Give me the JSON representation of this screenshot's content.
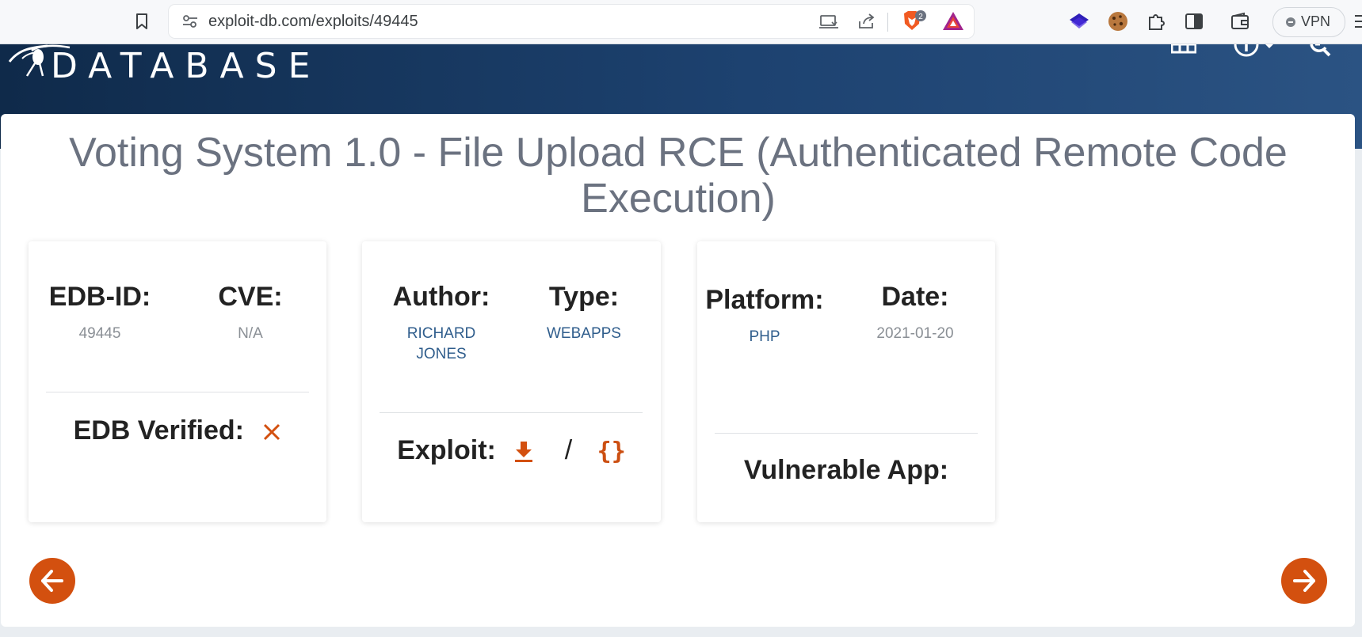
{
  "browser": {
    "url": "exploit-db.com/exploits/49445",
    "brave_shield_count": "2",
    "vpn_label": "VPN",
    "icons": [
      "bookmark-icon",
      "site-info-icon",
      "cast-icon",
      "share-icon",
      "brave-shield-icon",
      "brave-rewards-icon",
      "layers-extension-icon",
      "cookie-extension-icon",
      "puzzle-extension-icon",
      "sidebar-icon",
      "wallet-icon",
      "vpn-status-icon",
      "menu-icon"
    ]
  },
  "header": {
    "logo_text": "DATABASE",
    "icons": [
      "spider-logo-icon",
      "grid-icon",
      "info-icon",
      "chevron-down-icon",
      "search-icon"
    ]
  },
  "exploit": {
    "title": "Voting System 1.0 - File Upload RCE (Authenticated Remote Code Execution)",
    "edb_id_label": "EDB-ID:",
    "edb_id": "49445",
    "cve_label": "CVE:",
    "cve": "N/A",
    "verified_label": "EDB Verified:",
    "verified_icon": "x-icon",
    "author_label": "Author:",
    "author": "RICHARD JONES",
    "type_label": "Type:",
    "type": "WEBAPPS",
    "exploit_label": "Exploit:",
    "exploit_separator": "/",
    "raw_symbol": "{}",
    "platform_label": "Platform:",
    "platform": "PHP",
    "date_label": "Date:",
    "date": "2021-01-20",
    "vulnerable_app_label": "Vulnerable App:"
  },
  "colors": {
    "accent": "#d3500f",
    "link": "#2f5d8c",
    "header_dark": "#0f2a4a",
    "header_light": "#2b5383",
    "title": "#6b7280"
  },
  "navigation": {
    "previous_icon": "arrow-left-icon",
    "next_icon": "arrow-right-icon"
  }
}
